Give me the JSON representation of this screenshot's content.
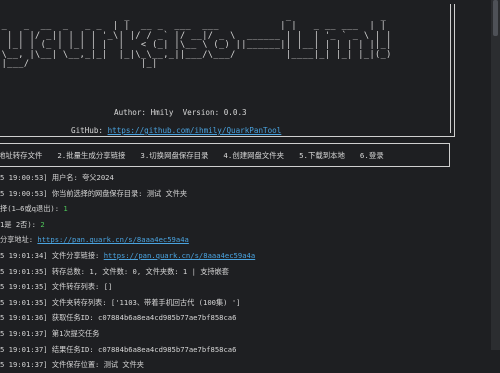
{
  "banner": {
    "ascii": [
      "                       _                            _                _",
      " _   _  __  _   _ _  | |  __ _  ___  ___           | |   _ __ ___  | |",
      "| | | |/ _|| | | | '_\\| |/ / _` |/ __|/ _ \\  ______ | |  | '_ ` _ \\ | |",
      "| |_| | (_ | |_| | |  |   < (_| |\\__ \\ (_) ||______|| |__| | | | | ||_|",
      " \\__, |\\__| \\__,_|_|  |_|\\_\\__,_||___/\\___/         |____|_| |_| |_|(_)",
      " |___/                    |_|                                           "
    ],
    "author_line": "Author: Hmily  Version: 0.0.3",
    "github_label": "GitHub: ",
    "github_url": "https://github.com/ihmily/QuarkPanTool"
  },
  "menu": [
    "地址转存文件",
    "2.批量生成分享链接",
    "3.切换网盘保存目录",
    "4.创建网盘文件夹",
    "5.下载到本地",
    "6.登录"
  ],
  "log": [
    {
      "type": "plain",
      "text": "5 19:00:53] 用户名: 夸父2024"
    },
    {
      "type": "plain",
      "text": "5 19:00:53] 你当前选择的网盘保存目录: 测试 文件夹"
    },
    {
      "type": "value",
      "text": "择(1—6或q退出): ",
      "value": "1"
    },
    {
      "type": "value",
      "text": "1是 2否): ",
      "value": "2"
    },
    {
      "type": "link",
      "text": "分享地址: ",
      "url": "https://pan.quark.cn/s/8aaa4ec59a4a"
    },
    {
      "type": "link",
      "text": "5 19:01:34] 文件分享链接: ",
      "url": "https://pan.quark.cn/s/8aaa4ec59a4a"
    },
    {
      "type": "plain",
      "text": "5 19:01:35] 转存总数: 1, 文件数: 0, 文件夹数: 1 | 支持嵌套"
    },
    {
      "type": "plain",
      "text": "5 19:01:35] 文件转存列表: []"
    },
    {
      "type": "plain",
      "text": "5 19:01:35] 文件夹转存列表: ['1103、带着手机回古代 (100集) ']"
    },
    {
      "type": "plain",
      "text": "5 19:01:36] 获取任务ID: c07884b6a8ea4cd985b77ae7bf858ca6"
    },
    {
      "type": "plain",
      "text": "5 19:01:37] 第1次提交任务"
    },
    {
      "type": "plain",
      "text": "5 19:01:37] 结果任务ID: c07884b6a8ea4cd985b77ae7bf858ca6"
    },
    {
      "type": "plain",
      "text": "5 19:01:37] 文件保存位置: 测试 文件夹"
    }
  ]
}
